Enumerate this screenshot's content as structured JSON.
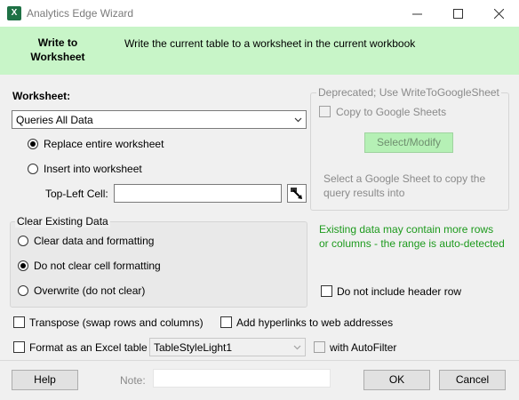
{
  "window": {
    "title": "Analytics Edge Wizard",
    "app_icon_letter": "X"
  },
  "header": {
    "title": "Write to Worksheet",
    "description": "Write the current table to a worksheet in the current workbook"
  },
  "worksheet": {
    "label": "Worksheet:",
    "selected": "Queries All Data",
    "options": [
      {
        "label": "Replace entire worksheet",
        "checked": true
      },
      {
        "label": "Insert into worksheet",
        "checked": false
      }
    ],
    "top_left_cell_label": "Top-Left Cell:",
    "top_left_cell_value": ""
  },
  "clear_existing": {
    "title": "Clear Existing Data",
    "options": [
      {
        "label": "Clear data and formatting",
        "checked": false
      },
      {
        "label": "Do not clear cell formatting",
        "checked": true
      },
      {
        "label": "Overwrite (do not clear)",
        "checked": false
      }
    ]
  },
  "google": {
    "group_title": "Deprecated; Use WriteToGoogleSheet",
    "copy_label": "Copy to Google Sheets",
    "select_button": "Select/Modify",
    "hint": "Select a Google Sheet to copy the query results into"
  },
  "warning_text": "Existing data may contain more rows or columns - the range is auto-detected",
  "options": {
    "no_header_row": "Do not include header row",
    "transpose": "Transpose (swap rows and columns)",
    "hyperlinks": "Add hyperlinks to web addresses",
    "format_table": "Format as an Excel table",
    "table_style": "TableStyleLight1",
    "autofilter": "with AutoFilter"
  },
  "footer": {
    "help": "Help",
    "note_label": "Note:",
    "note_value": "",
    "ok": "OK",
    "cancel": "Cancel"
  },
  "colors": {
    "header_bg": "#c8f5c8",
    "warning_text": "#1d9a1d",
    "select_button_bg": "#b5f0b5"
  }
}
